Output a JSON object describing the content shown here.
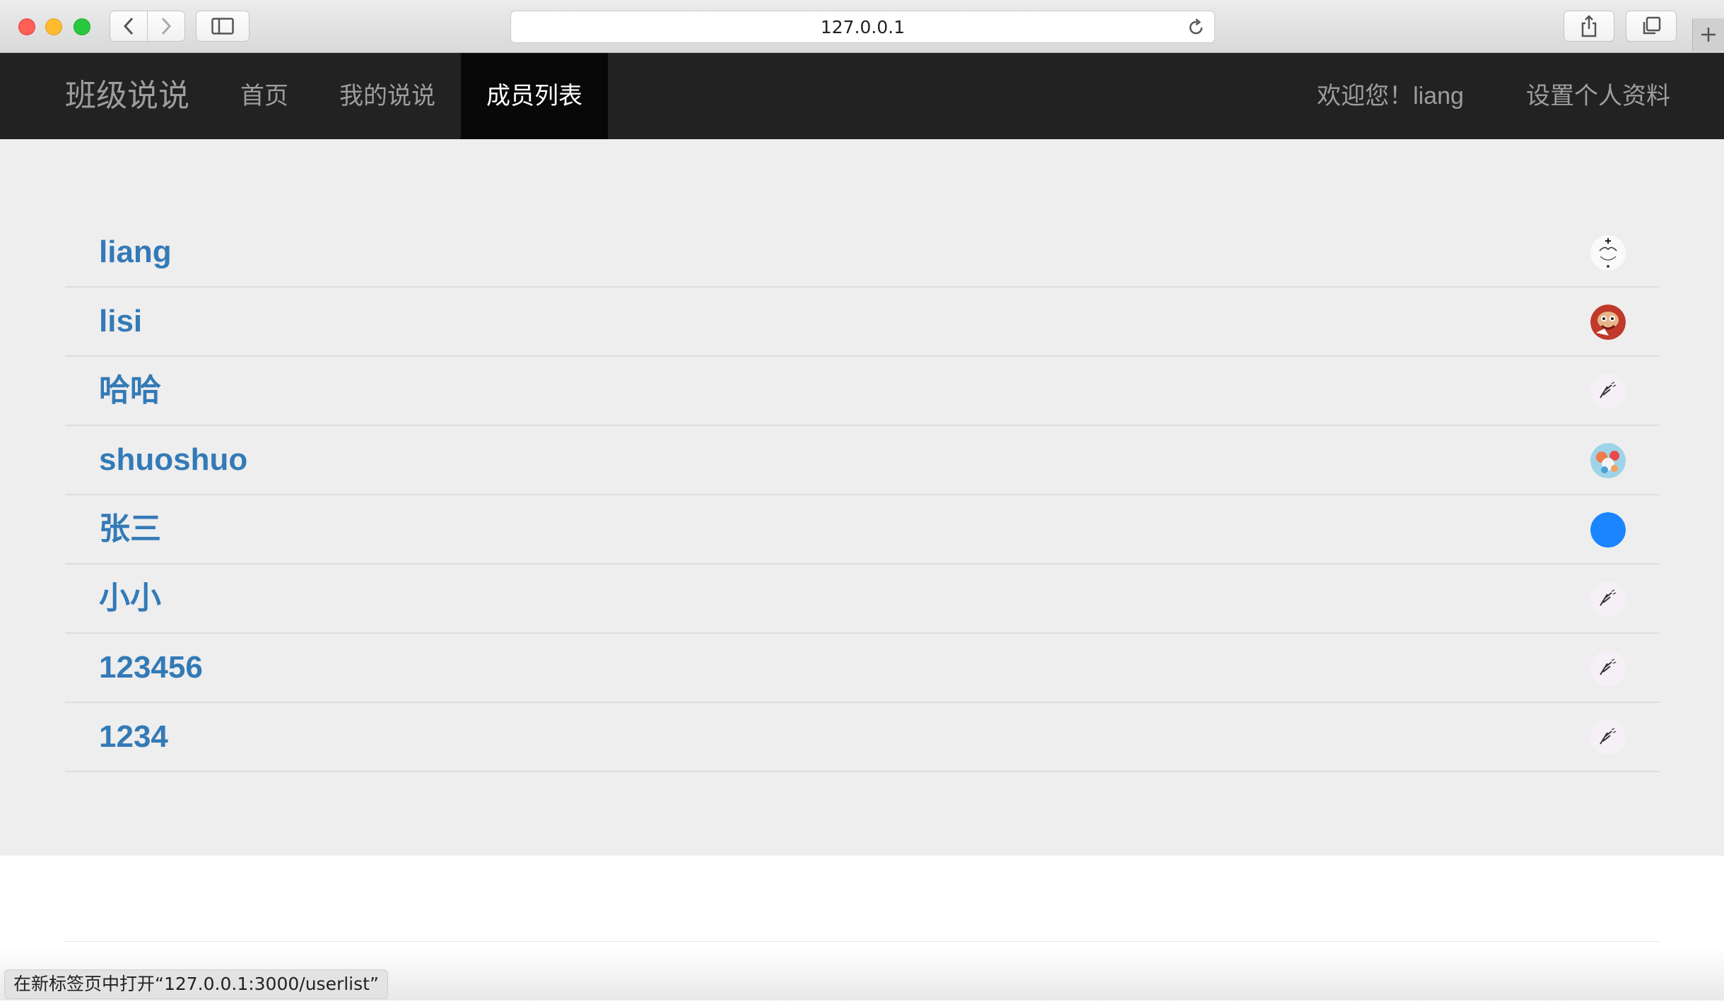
{
  "browser": {
    "url": "127.0.0.1",
    "status_bar": "在新标签页中打开“127.0.0.1:3000/userlist”"
  },
  "navbar": {
    "brand": "班级说说",
    "links": {
      "home": "首页",
      "mine": "我的说说",
      "members": "成员列表"
    },
    "welcome": "欢迎您！liang",
    "profile": "设置个人资料"
  },
  "members": [
    {
      "name": "liang",
      "avatar_icon": "sketch-avatar-icon"
    },
    {
      "name": "lisi",
      "avatar_icon": "red-cartoon-avatar-icon"
    },
    {
      "name": "哈哈",
      "avatar_icon": "default-sketch-avatar-icon"
    },
    {
      "name": "shuoshuo",
      "avatar_icon": "colorful-avatar-icon"
    },
    {
      "name": "张三",
      "avatar_icon": "blue-circle-avatar-icon"
    },
    {
      "name": "小小",
      "avatar_icon": "default-sketch-avatar-icon"
    },
    {
      "name": "123456",
      "avatar_icon": "default-sketch-avatar-icon"
    },
    {
      "name": "1234",
      "avatar_icon": "default-sketch-avatar-icon"
    }
  ],
  "footer": {
    "text": "© ∧∧∧∧ ∨∨∨∨∧∧∧∧∧"
  },
  "colors": {
    "navbar_bg": "#222222",
    "active_nav_bg": "#080808",
    "link_blue": "#337ab7",
    "jumbotron_bg": "#eeeeee",
    "avatar_blue": "#1a85ff"
  }
}
